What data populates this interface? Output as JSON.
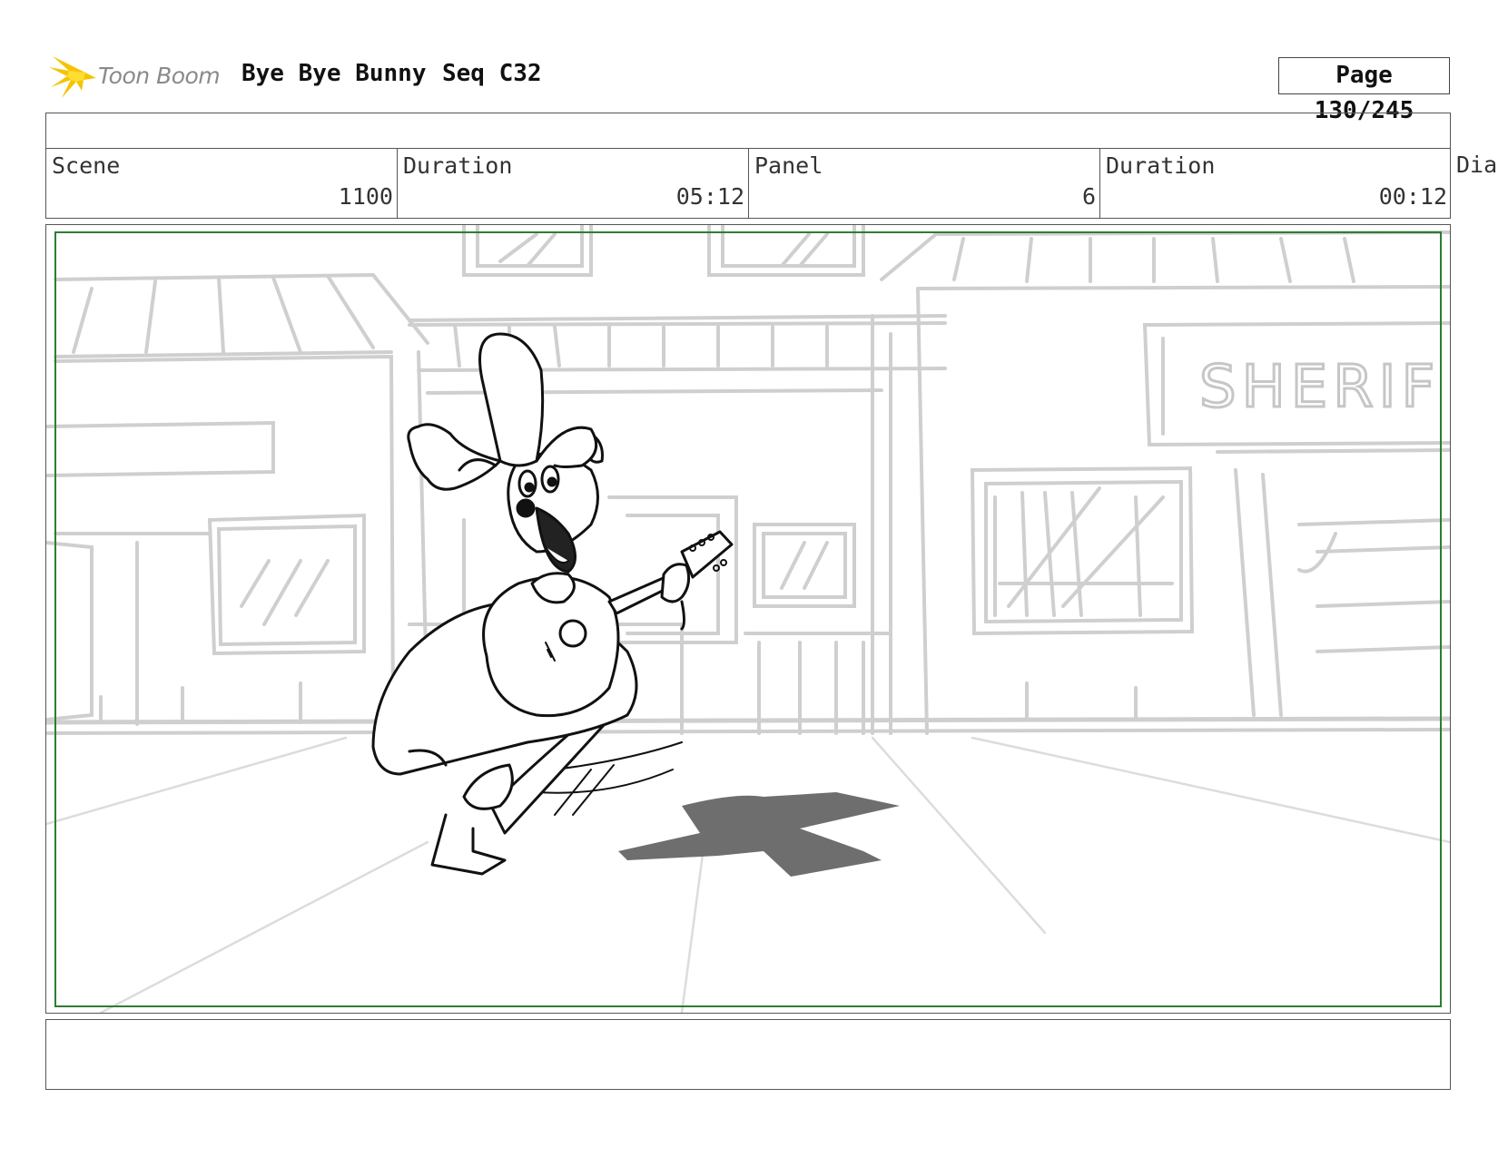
{
  "header": {
    "logo_text": "Toon Boom",
    "project_title": "Bye Bye Bunny",
    "sequence": "Seq C32",
    "page": "Page 130/245"
  },
  "info": {
    "scene_label": "Scene",
    "scene_value": "1100",
    "scene_duration_label": "Duration",
    "scene_duration_value": "05:12",
    "panel_label": "Panel",
    "panel_value": "6",
    "panel_duration_label": "Duration",
    "panel_duration_value": "00:12",
    "dialog_label": "Dia"
  },
  "drawing": {
    "sign_text": "SHERIF",
    "safe_frame_color": "#2e7d32",
    "sketch_color": "#c8c8c8",
    "shadow_color": "#6a6a6a"
  },
  "notes": {
    "text": ""
  }
}
